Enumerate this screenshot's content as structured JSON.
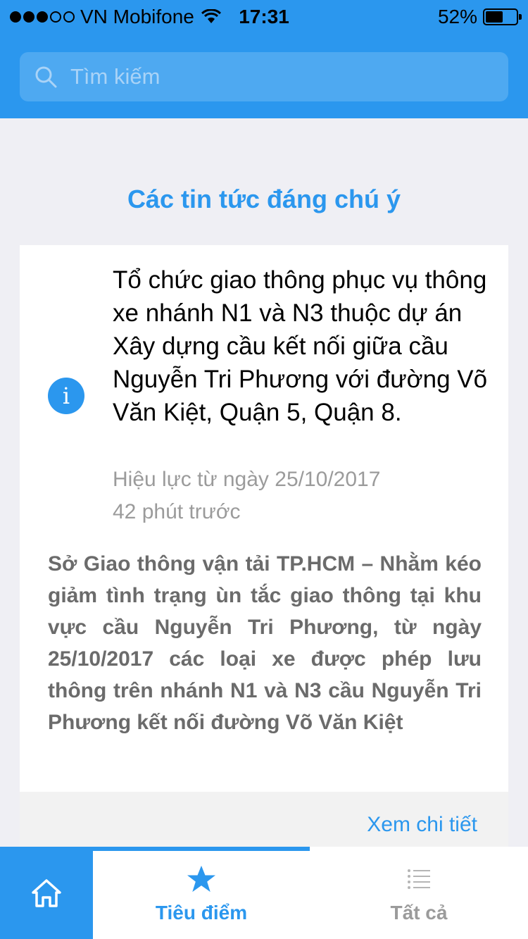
{
  "status_bar": {
    "carrier": "VN Mobifone",
    "time": "17:31",
    "battery": "52%",
    "signal_bars": 3,
    "battery_level": 0.52
  },
  "search": {
    "placeholder": "Tìm kiếm",
    "icon": "search-icon"
  },
  "section_title": "Các tin tức đáng chú ý",
  "news_card": {
    "icon": "info-icon",
    "icon_glyph": "i",
    "title": "Tổ chức giao thông phục vụ thông xe nhánh N1 và N3 thuộc dự án Xây dựng cầu kết nối giữa cầu Nguyễn Tri Phương với đường Võ Văn Kiệt, Quận 5, Quận 8.",
    "effective": "Hiệu lực từ ngày 25/10/2017",
    "time_ago": "42 phút trước",
    "summary": "Sở Giao thông vận tải TP.HCM – Nhằm kéo giảm tình trạng ùn tắc giao thông tại khu vực cầu Nguyễn Tri Phương, từ ngày 25/10/2017 các loại xe được phép lưu thông trên nhánh N1 và N3 cầu Nguyễn Tri Phương kết nối đường Võ Văn Kiệt",
    "detail_link": "Xem chi tiết"
  },
  "tab_bar": {
    "home_icon": "home-icon",
    "tabs": [
      {
        "label": "Tiêu điểm",
        "icon": "star-icon",
        "active": true
      },
      {
        "label": "Tất cả",
        "icon": "list-icon",
        "active": false
      }
    ]
  },
  "colors": {
    "accent": "#2b97ee",
    "background": "#efeff4",
    "muted_text": "#9b9b9b"
  }
}
